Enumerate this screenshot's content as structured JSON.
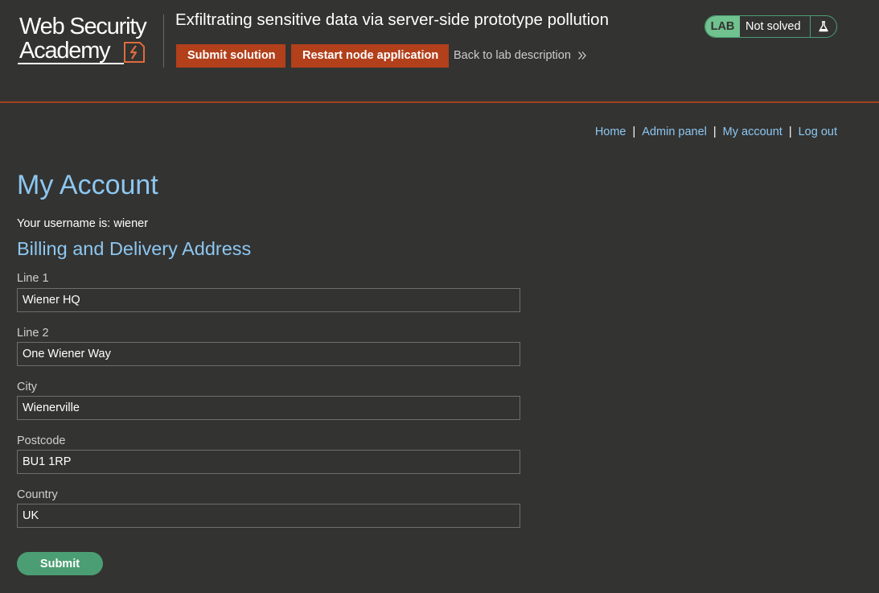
{
  "header": {
    "logo": {
      "line1": "Web Security",
      "line2": "Academy"
    },
    "lab_title": "Exfiltrating sensitive data via server-side prototype pollution",
    "submit_solution_label": "Submit solution",
    "restart_label": "Restart node application",
    "back_link_label": "Back to lab description",
    "status": {
      "badge": "LAB",
      "text": "Not solved",
      "icon": "flask-icon",
      "accent_color": "#70c28e"
    },
    "accent_color": "#b2401b"
  },
  "nav": {
    "items": [
      {
        "label": "Home"
      },
      {
        "label": "Admin panel"
      },
      {
        "label": "My account"
      },
      {
        "label": "Log out"
      }
    ],
    "separator": "|"
  },
  "main": {
    "title": "My Account",
    "username_line": "Your username is: wiener",
    "section_title": "Billing and Delivery Address",
    "fields": [
      {
        "label": "Line 1",
        "value": "Wiener HQ"
      },
      {
        "label": "Line 2",
        "value": "One Wiener Way"
      },
      {
        "label": "City",
        "value": "Wienerville"
      },
      {
        "label": "Postcode",
        "value": "BU1 1RP"
      },
      {
        "label": "Country",
        "value": "UK"
      }
    ],
    "submit_label": "Submit"
  }
}
